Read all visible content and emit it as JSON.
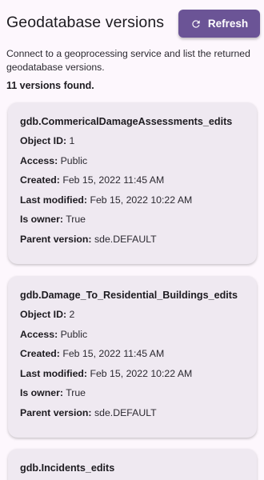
{
  "header": {
    "title": "Geodatabase versions",
    "refresh_label": "Refresh",
    "refresh_icon": "refresh-icon"
  },
  "description": "Connect to a geoprocessing service and list the returned geodatabase versions.",
  "count_text": "11 versions found.",
  "labels": {
    "object_id": "Object ID:",
    "access": "Access:",
    "created": "Created:",
    "last_modified": "Last modified:",
    "is_owner": "Is owner:",
    "parent_version": "Parent version:"
  },
  "versions": [
    {
      "name": "gdb.CommericalDamageAssessments_edits",
      "object_id": "1",
      "access": "Public",
      "created": "Feb 15, 2022 11:45 AM",
      "last_modified": "Feb 15, 2022 10:22 AM",
      "is_owner": "True",
      "parent_version": "sde.DEFAULT"
    },
    {
      "name": "gdb.Damage_To_Residential_Buildings_edits",
      "object_id": "2",
      "access": "Public",
      "created": "Feb 15, 2022 11:45 AM",
      "last_modified": "Feb 15, 2022 10:22 AM",
      "is_owner": "True",
      "parent_version": "sde.DEFAULT"
    },
    {
      "name": "gdb.Incidents_edits"
    }
  ],
  "colors": {
    "background": "#fdf7fd",
    "button": "#6b5496",
    "card": "#efe9f1",
    "text": "#1d1b20"
  }
}
